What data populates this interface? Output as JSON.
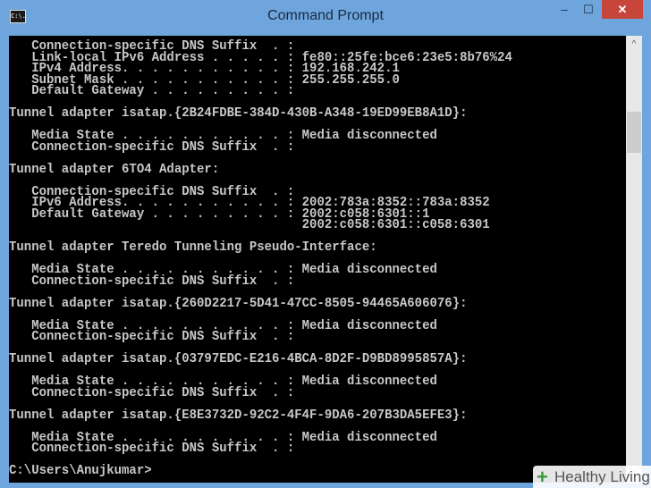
{
  "window": {
    "title": "Command Prompt",
    "minimize": "–",
    "maximize": "☐",
    "close": "✕",
    "icon_label": "C:\\."
  },
  "console": {
    "lines": [
      "   Connection-specific DNS Suffix  . :",
      "   Link-local IPv6 Address . . . . . : fe80::25fe:bce6:23e5:8b76%24",
      "   IPv4 Address. . . . . . . . . . . : 192.168.242.1",
      "   Subnet Mask . . . . . . . . . . . : 255.255.255.0",
      "   Default Gateway . . . . . . . . . :",
      "",
      "Tunnel adapter isatap.{2B24FDBE-384D-430B-A348-19ED99EB8A1D}:",
      "",
      "   Media State . . . . . . . . . . . : Media disconnected",
      "   Connection-specific DNS Suffix  . :",
      "",
      "Tunnel adapter 6TO4 Adapter:",
      "",
      "   Connection-specific DNS Suffix  . :",
      "   IPv6 Address. . . . . . . . . . . : 2002:783a:8352::783a:8352",
      "   Default Gateway . . . . . . . . . : 2002:c058:6301::1",
      "                                       2002:c058:6301::c058:6301",
      "",
      "Tunnel adapter Teredo Tunneling Pseudo-Interface:",
      "",
      "   Media State . . . . . . . . . . . : Media disconnected",
      "   Connection-specific DNS Suffix  . :",
      "",
      "Tunnel adapter isatap.{260D2217-5D41-47CC-8505-94465A606076}:",
      "",
      "   Media State . . . . . . . . . . . : Media disconnected",
      "   Connection-specific DNS Suffix  . :",
      "",
      "Tunnel adapter isatap.{03797EDC-E216-4BCA-8D2F-D9BD8995857A}:",
      "",
      "   Media State . . . . . . . . . . . : Media disconnected",
      "   Connection-specific DNS Suffix  . :",
      "",
      "Tunnel adapter isatap.{E8E3732D-92C2-4F4F-9DA6-207B3DA5EFE3}:",
      "",
      "   Media State . . . . . . . . . . . : Media disconnected",
      "   Connection-specific DNS Suffix  . :",
      "",
      "C:\\Users\\Anujkumar>"
    ]
  },
  "scrollbar": {
    "up_arrow": "^"
  },
  "watermark": {
    "text": "Healthy Living",
    "icon": "+"
  }
}
